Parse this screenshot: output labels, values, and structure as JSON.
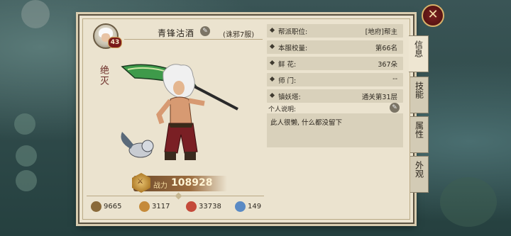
{
  "profile": {
    "level": "43",
    "name": "青锋沽酒",
    "server": "(诛邪7服)",
    "seal_text": "绝灭"
  },
  "combat_power": {
    "label": "战力",
    "value": "108928"
  },
  "stats": [
    {
      "icon": "sword-icon",
      "value": "9665",
      "color": "#8a6a3a"
    },
    {
      "icon": "shield-icon",
      "value": "3117",
      "color": "#c58a3a"
    },
    {
      "icon": "heart-icon",
      "value": "33738",
      "color": "#c44a3a"
    },
    {
      "icon": "orb-icon",
      "value": "149",
      "color": "#5a8ac4"
    }
  ],
  "info_rows": [
    {
      "key": "帮派职位:",
      "value": "[地府]帮主"
    },
    {
      "key": "本服校量:",
      "value": "第66名"
    },
    {
      "key": "鲜  花:",
      "value": "367朵"
    },
    {
      "key": "师  门:",
      "value": "--"
    },
    {
      "key": "镇妖塔:",
      "value": "通关第31层"
    }
  ],
  "description": {
    "label": "个人说明:",
    "text": "此人很懒, 什么都没留下"
  },
  "tabs": [
    {
      "label": "信息",
      "active": true
    },
    {
      "label": "技能",
      "active": false
    },
    {
      "label": "属性",
      "active": false
    },
    {
      "label": "外观",
      "active": false
    }
  ],
  "close_symbol": "✕"
}
